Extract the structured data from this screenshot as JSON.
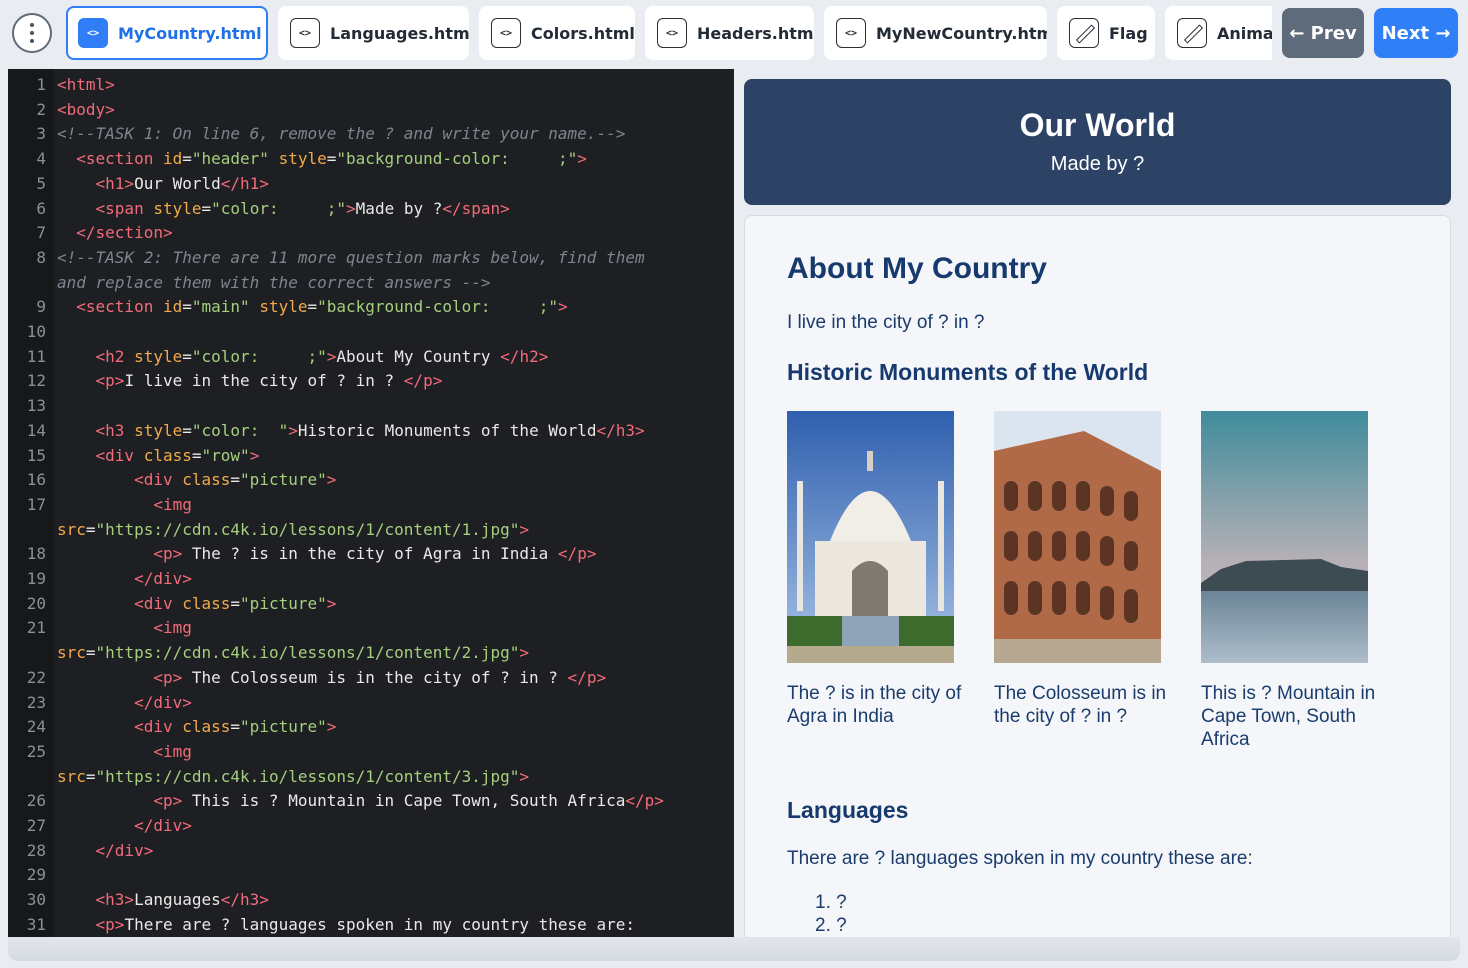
{
  "tabs": [
    {
      "label": "MyCountry.html",
      "icon": "file-code-icon",
      "active": true
    },
    {
      "label": "Languages.html",
      "icon": "file-code-icon"
    },
    {
      "label": "Colors.html",
      "icon": "file-code-icon"
    },
    {
      "label": "Headers.html",
      "icon": "file-code-icon"
    },
    {
      "label": "MyNewCountry.html",
      "icon": "file-code-icon"
    },
    {
      "label": "Flag",
      "icon": "pencil-icon"
    },
    {
      "label": "Animal",
      "icon": "pencil-icon"
    }
  ],
  "nav": {
    "prev": "← Prev",
    "next": "Next →"
  },
  "preview": {
    "header_title": "Our World",
    "header_sub": "Made by ?",
    "h2": "About My Country",
    "p1": "I live in the city of ? in ?",
    "h3_monuments": "Historic Monuments of the World",
    "pictures": [
      {
        "caption": "The ? is in the city of Agra in India",
        "alt": "taj-mahal"
      },
      {
        "caption": "The Colosseum is in the city of ? in ?",
        "alt": "colosseum"
      },
      {
        "caption": "This is ? Mountain in Cape Town, South Africa",
        "alt": "table-mountain"
      }
    ],
    "h3_languages": "Languages",
    "p_languages": "There are ? languages spoken in my country these are:",
    "list": [
      "1. ?",
      "2. ?"
    ]
  },
  "colors": {
    "accent": "#2f7ef7",
    "header_bg": "#2c4366",
    "heading": "#173a6e",
    "editor_bg": "#1e1f22"
  },
  "code_lines": [
    {
      "n": "1",
      "html": "<span class=\"t\">&lt;html&gt;</span>"
    },
    {
      "n": "2",
      "html": "<span class=\"t\">&lt;body&gt;</span>"
    },
    {
      "n": "3",
      "html": "<span class=\"c\">&lt;!--TASK 1: On line 6, remove the ? and write your name.--&gt;</span>"
    },
    {
      "n": "4",
      "html": "  <span class=\"t\">&lt;section</span> <span class=\"a\">id</span>=<span class=\"s\">\"header\"</span> <span class=\"a\">style</span>=<span class=\"s\">\"background-color:</span>     <span class=\"s\">;\"</span><span class=\"t\">&gt;</span>"
    },
    {
      "n": "5",
      "html": "    <span class=\"t\">&lt;h1&gt;</span>Our World<span class=\"t\">&lt;/h1&gt;</span>"
    },
    {
      "n": "6",
      "html": "    <span class=\"t\">&lt;span</span> <span class=\"a\">style</span>=<span class=\"s\">\"color:</span>     <span class=\"s\">;\"</span><span class=\"t\">&gt;</span>Made by ?<span class=\"t\">&lt;/span&gt;</span>"
    },
    {
      "n": "7",
      "html": "  <span class=\"t\">&lt;/section&gt;</span>"
    },
    {
      "n": "8",
      "html": "<span class=\"c\">&lt;!--TASK 2: There are 11 more question marks below, find them</span>"
    },
    {
      "n": "",
      "html": "<span class=\"c\">and replace them with the correct answers --&gt;</span>"
    },
    {
      "n": "9",
      "html": "  <span class=\"t\">&lt;section</span> <span class=\"a\">id</span>=<span class=\"s\">\"main\"</span> <span class=\"a\">style</span>=<span class=\"s\">\"background-color:</span>     <span class=\"s\">;\"</span><span class=\"t\">&gt;</span>"
    },
    {
      "n": "10",
      "html": ""
    },
    {
      "n": "11",
      "html": "    <span class=\"t\">&lt;h2</span> <span class=\"a\">style</span>=<span class=\"s\">\"color:</span>     <span class=\"s\">;\"</span><span class=\"t\">&gt;</span>About My Country <span class=\"t\">&lt;/h2&gt;</span>"
    },
    {
      "n": "12",
      "html": "    <span class=\"t\">&lt;p&gt;</span>I live in the city of ? in ? <span class=\"t\">&lt;/p&gt;</span>"
    },
    {
      "n": "13",
      "html": ""
    },
    {
      "n": "14",
      "html": "    <span class=\"t\">&lt;h3</span> <span class=\"a\">style</span>=<span class=\"s\">\"color:</span>  <span class=\"s\">\"</span><span class=\"t\">&gt;</span>Historic Monuments of the World<span class=\"t\">&lt;/h3&gt;</span>"
    },
    {
      "n": "15",
      "html": "    <span class=\"t\">&lt;div</span> <span class=\"a\">class</span>=<span class=\"s\">\"row\"</span><span class=\"t\">&gt;</span>"
    },
    {
      "n": "16",
      "html": "        <span class=\"t\">&lt;div</span> <span class=\"a\">class</span>=<span class=\"s\">\"picture\"</span><span class=\"t\">&gt;</span>"
    },
    {
      "n": "17",
      "html": "          <span class=\"t\">&lt;img</span>"
    },
    {
      "n": "",
      "html": "<span class=\"a\">src</span>=<span class=\"s\">\"https://cdn.c4k.io/lessons/1/content/1.jpg\"</span><span class=\"t\">&gt;</span>"
    },
    {
      "n": "18",
      "html": "          <span class=\"t\">&lt;p&gt;</span> The ? is in the city of Agra in India <span class=\"t\">&lt;/p&gt;</span>"
    },
    {
      "n": "19",
      "html": "        <span class=\"t\">&lt;/div&gt;</span>"
    },
    {
      "n": "20",
      "html": "        <span class=\"t\">&lt;div</span> <span class=\"a\">class</span>=<span class=\"s\">\"picture\"</span><span class=\"t\">&gt;</span>"
    },
    {
      "n": "21",
      "html": "          <span class=\"t\">&lt;img</span>"
    },
    {
      "n": "",
      "html": "<span class=\"a\">src</span>=<span class=\"s\">\"https://cdn.c4k.io/lessons/1/content/2.jpg\"</span><span class=\"t\">&gt;</span>"
    },
    {
      "n": "22",
      "html": "          <span class=\"t\">&lt;p&gt;</span> The Colosseum is in the city of ? in ? <span class=\"t\">&lt;/p&gt;</span>"
    },
    {
      "n": "23",
      "html": "        <span class=\"t\">&lt;/div&gt;</span>"
    },
    {
      "n": "24",
      "html": "        <span class=\"t\">&lt;div</span> <span class=\"a\">class</span>=<span class=\"s\">\"picture\"</span><span class=\"t\">&gt;</span>"
    },
    {
      "n": "25",
      "html": "          <span class=\"t\">&lt;img</span>"
    },
    {
      "n": "",
      "html": "<span class=\"a\">src</span>=<span class=\"s\">\"https://cdn.c4k.io/lessons/1/content/3.jpg\"</span><span class=\"t\">&gt;</span>"
    },
    {
      "n": "26",
      "html": "          <span class=\"t\">&lt;p&gt;</span> This is ? Mountain in Cape Town, South Africa<span class=\"t\">&lt;/p&gt;</span>"
    },
    {
      "n": "27",
      "html": "        <span class=\"t\">&lt;/div&gt;</span>"
    },
    {
      "n": "28",
      "html": "    <span class=\"t\">&lt;/div&gt;</span>"
    },
    {
      "n": "29",
      "html": ""
    },
    {
      "n": "30",
      "html": "    <span class=\"t\">&lt;h3&gt;</span>Languages<span class=\"t\">&lt;/h3&gt;</span>"
    },
    {
      "n": "31",
      "html": "    <span class=\"t\">&lt;p&gt;</span>There are ? languages spoken in my country these are:"
    }
  ]
}
